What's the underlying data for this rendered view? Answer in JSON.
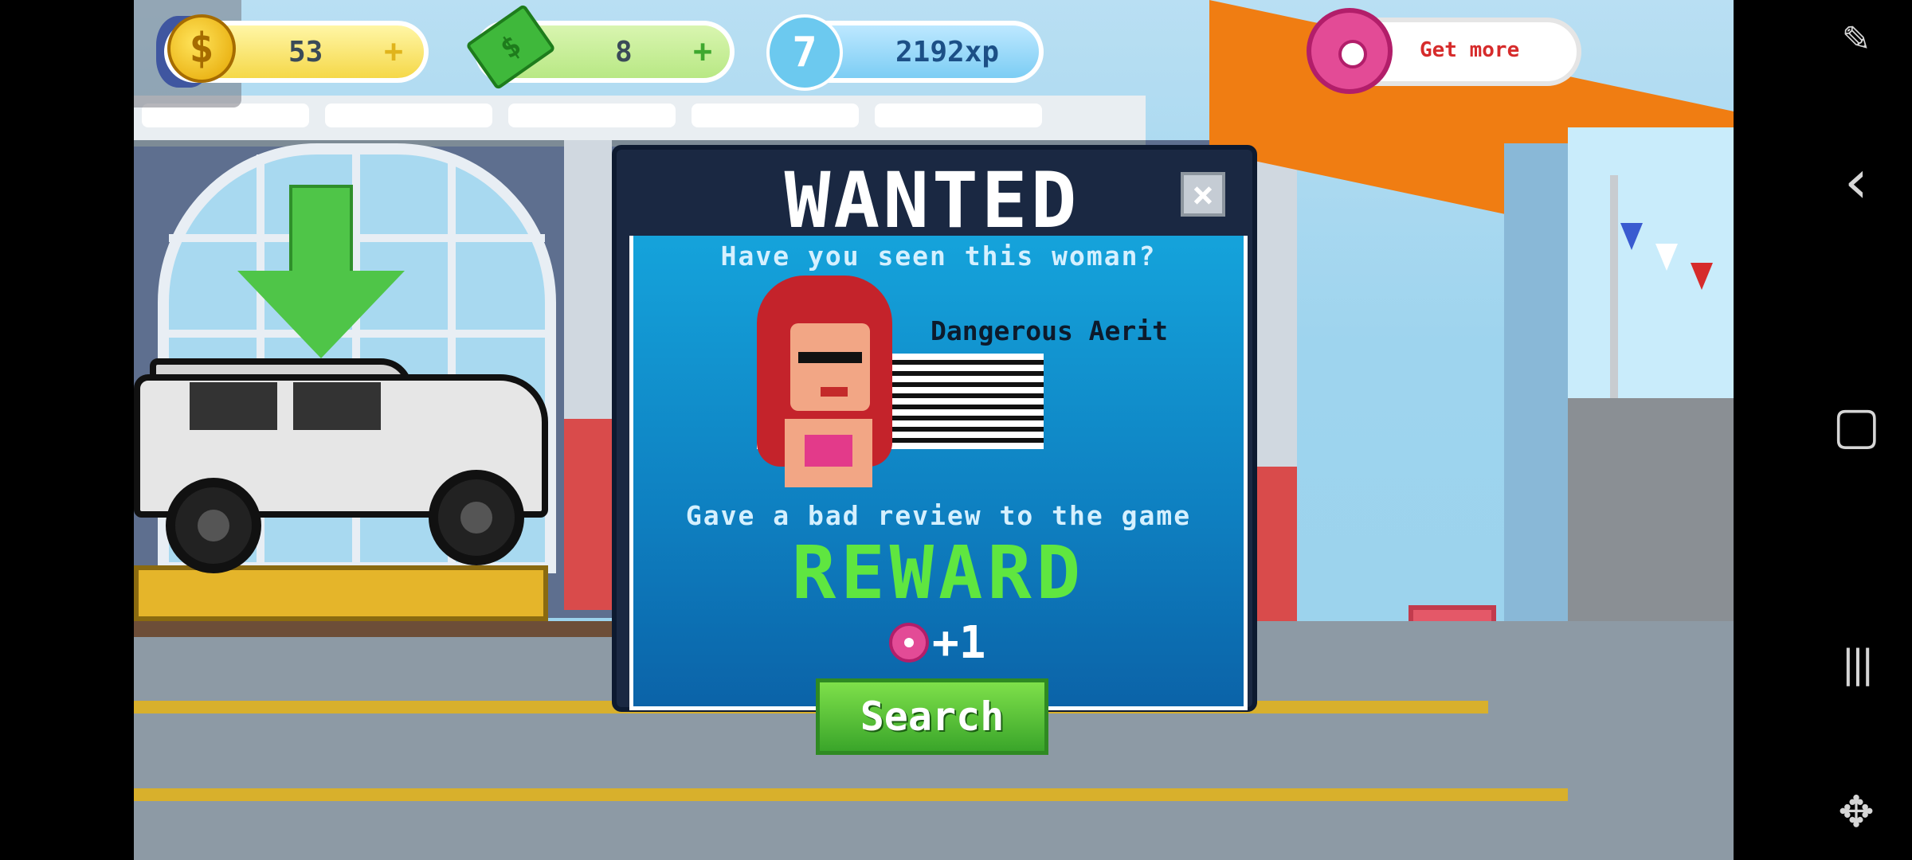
{
  "hud": {
    "coins": "53",
    "cash": "8",
    "xp_level": "7",
    "xp": "2192xp",
    "get_more": "Get more",
    "plus": "+"
  },
  "modal": {
    "title": "WANTED",
    "close": "×",
    "question": "Have you seen this woman?",
    "suspect_name": "Dangerous Aerit",
    "crime": "Gave a bad review to the game",
    "reward_title": "REWARD",
    "reward_amount": "+1",
    "search_label": "Search"
  },
  "icons": {
    "coin": "$",
    "nav_back": "‹",
    "nav_home": "▢",
    "nav_recents": "|||",
    "nav_game": "✥"
  },
  "colors": {
    "reward_green": "#5fe640",
    "get_more_red": "#d62b2b",
    "modal_blue": "#0e7fc0"
  }
}
